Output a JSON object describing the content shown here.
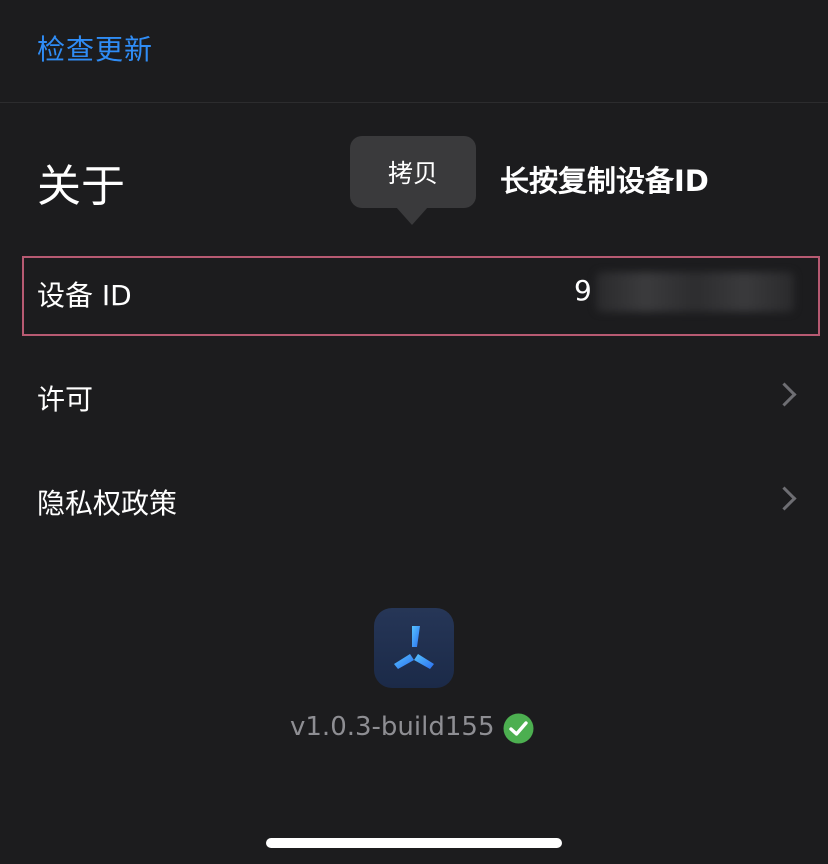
{
  "header": {
    "check_update_label": "检查更新"
  },
  "about": {
    "title": "关于",
    "tooltip_copy": "拷贝",
    "annotation": "长按复制设备ID"
  },
  "rows": {
    "device_id_label": "设备 ID",
    "device_id_value_visible": "9",
    "license_label": "许可",
    "privacy_label": "隐私权政策"
  },
  "footer": {
    "version": "v1.0.3-build155"
  },
  "icons": {
    "chevron": "chevron-right-icon",
    "app": "app-logo-icon",
    "verified": "checkmark-circle-icon"
  },
  "colors": {
    "background": "#1c1c1e",
    "link": "#2f8cf5",
    "highlight_border": "#b75a72",
    "verified_green": "#4caf50",
    "secondary_text": "#8e8e93"
  }
}
